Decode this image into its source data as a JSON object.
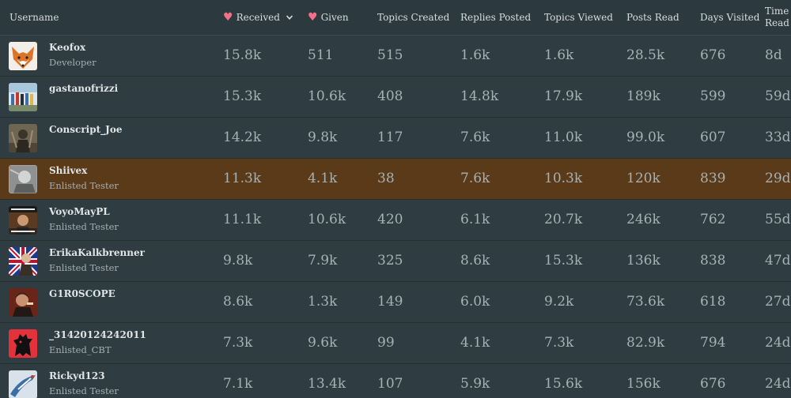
{
  "header": {
    "username": "Username",
    "received": "Received",
    "given": "Given",
    "topics_created": "Topics Created",
    "replies_posted": "Replies Posted",
    "topics_viewed": "Topics Viewed",
    "posts_read": "Posts Read",
    "days_visited": "Days Visited",
    "time_read_line1": "Time",
    "time_read_line2": "Read",
    "heart_icon": "heart-icon",
    "sort_icon": "chevron-down-icon",
    "accent_color": "#f2708a"
  },
  "rows": [
    {
      "username": "Keofox",
      "title": "Developer",
      "received": "15.8k",
      "given": "511",
      "topics_created": "515",
      "replies_posted": "1.6k",
      "topics_viewed": "1.6k",
      "posts_read": "28.5k",
      "days_visited": "676",
      "time_read": "8d",
      "avatar": "fox-avatar"
    },
    {
      "username": "gastanofrizzi",
      "title": "",
      "received": "15.3k",
      "given": "10.6k",
      "topics_created": "408",
      "replies_posted": "14.8k",
      "topics_viewed": "17.9k",
      "posts_read": "189k",
      "days_visited": "599",
      "time_read": "59d",
      "avatar": "group-photo-avatar"
    },
    {
      "username": "Conscript_Joe",
      "title": "",
      "received": "14.2k",
      "given": "9.8k",
      "topics_created": "117",
      "replies_posted": "7.6k",
      "topics_viewed": "11.0k",
      "posts_read": "99.0k",
      "days_visited": "607",
      "time_read": "33d",
      "avatar": "soldier-avatar"
    },
    {
      "username": "Shiivex",
      "title": "Enlisted Tester",
      "received": "11.3k",
      "given": "4.1k",
      "topics_created": "38",
      "replies_posted": "7.6k",
      "topics_viewed": "10.3k",
      "posts_read": "120k",
      "days_visited": "839",
      "time_read": "29d",
      "avatar": "grayscale-avatar",
      "highlight": true,
      "highlight_color": "#5a3a19"
    },
    {
      "username": "VoyoMayPL",
      "title": "Enlisted Tester",
      "received": "11.1k",
      "given": "10.6k",
      "topics_created": "420",
      "replies_posted": "6.1k",
      "topics_viewed": "20.7k",
      "posts_read": "246k",
      "days_visited": "762",
      "time_read": "55d",
      "avatar": "meme-avatar"
    },
    {
      "username": "ErikaKalkbrenner",
      "title": "Enlisted Tester",
      "received": "9.8k",
      "given": "7.9k",
      "topics_created": "325",
      "replies_posted": "8.6k",
      "topics_viewed": "15.3k",
      "posts_read": "136k",
      "days_visited": "838",
      "time_read": "47d",
      "avatar": "flag-avatar"
    },
    {
      "username": "G1R0SCOPE",
      "title": "",
      "received": "8.6k",
      "given": "1.3k",
      "topics_created": "149",
      "replies_posted": "6.0k",
      "topics_viewed": "9.2k",
      "posts_read": "73.6k",
      "days_visited": "618",
      "time_read": "27d",
      "avatar": "portrait-avatar"
    },
    {
      "username": "_31420124242011",
      "title": "Enlisted_CBT",
      "received": "7.3k",
      "given": "9.6k",
      "topics_created": "99",
      "replies_posted": "4.1k",
      "topics_viewed": "7.3k",
      "posts_read": "82.9k",
      "days_visited": "794",
      "time_read": "24d",
      "avatar": "red-monster-avatar"
    },
    {
      "username": "Rickyd123",
      "title": "Enlisted Tester",
      "received": "7.1k",
      "given": "13.4k",
      "topics_created": "107",
      "replies_posted": "5.9k",
      "topics_viewed": "15.6k",
      "posts_read": "156k",
      "days_visited": "676",
      "time_read": "24d",
      "avatar": "jet-avatar"
    }
  ]
}
